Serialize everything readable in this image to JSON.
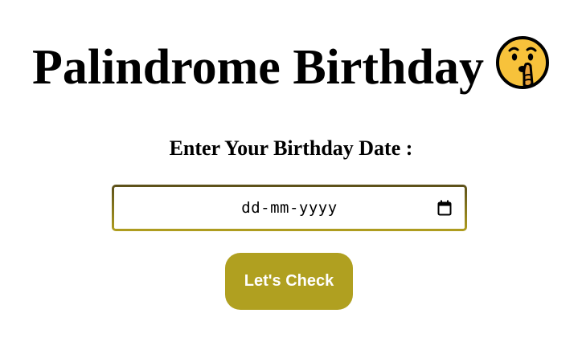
{
  "header": {
    "title": "Palindrome Birthday",
    "emoji_icon": "shushing-face-icon"
  },
  "form": {
    "label": "Enter Your Birthday Date :",
    "date_placeholder": "dd-mm-yyyy",
    "calendar_icon": "calendar-icon",
    "submit_label": "Let's Check"
  },
  "colors": {
    "accent": "#b0a020",
    "input_border_top": "#5b4f1a",
    "input_border_bottom": "#b09e1f",
    "emoji_face": "#f7c23b"
  }
}
